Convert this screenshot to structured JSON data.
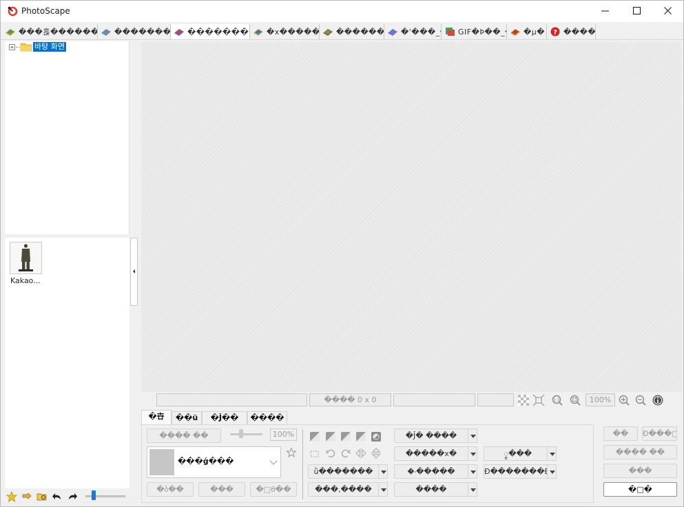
{
  "app": {
    "title": "PhotoScape"
  },
  "window_controls": {
    "minimize": "minimize",
    "maximize": "maximize",
    "close": "close"
  },
  "tabs": [
    {
      "label": "���흕������",
      "icon": "viewer-book-icon"
    },
    {
      "label": "�������",
      "icon": "editor-book-icon"
    },
    {
      "label": "��������",
      "icon": "batch-book-icon",
      "active": true
    },
    {
      "label": "�x�����",
      "icon": "page-book-icon"
    },
    {
      "label": "������",
      "icon": "combine-book-icon"
    },
    {
      "label": "�'���_�",
      "icon": "print-book-icon"
    },
    {
      "label": "GIF�Þ��_�",
      "icon": "gif-icon"
    },
    {
      "label": "�µ�",
      "icon": "print-icon"
    },
    {
      "label": "����",
      "icon": "help-icon"
    }
  ],
  "folder_tree": {
    "root_label": "바탕 화면",
    "expander": "+"
  },
  "thumbnails": [
    {
      "label": "Kakao..."
    }
  ],
  "statusbar": {
    "size_text": "���� 0 x 0",
    "zoom": "100%"
  },
  "edit_tabs": [
    {
      "label": "�卋",
      "active": true
    },
    {
      "label": "��ü"
    },
    {
      "label": "�Ĵ��"
    },
    {
      "label": "����"
    }
  ],
  "edit_panel": {
    "resize_button": "���� ��",
    "resize_percent": "100%",
    "frame_name": "���ǵ���",
    "btn_bottom_1": "�ბ��",
    "btn_bottom_2": "���",
    "btn_bottom_3": "�□θ��",
    "dd_1": "�Ĵ� ����",
    "dd_2": "�����x�",
    "dd_3": "ǜ�������",
    "dd_4": "�ං�����",
    "dd_5": "���,����",
    "dd_6": "����",
    "dd_7": "�ၘ���",
    "dd_8": "Ð�������Ð"
  },
  "right_panel": {
    "btn_1": "��",
    "btn_2": "Ð���□",
    "btn_3": "���� ��",
    "btn_4": "���",
    "btn_save": "�□�"
  }
}
